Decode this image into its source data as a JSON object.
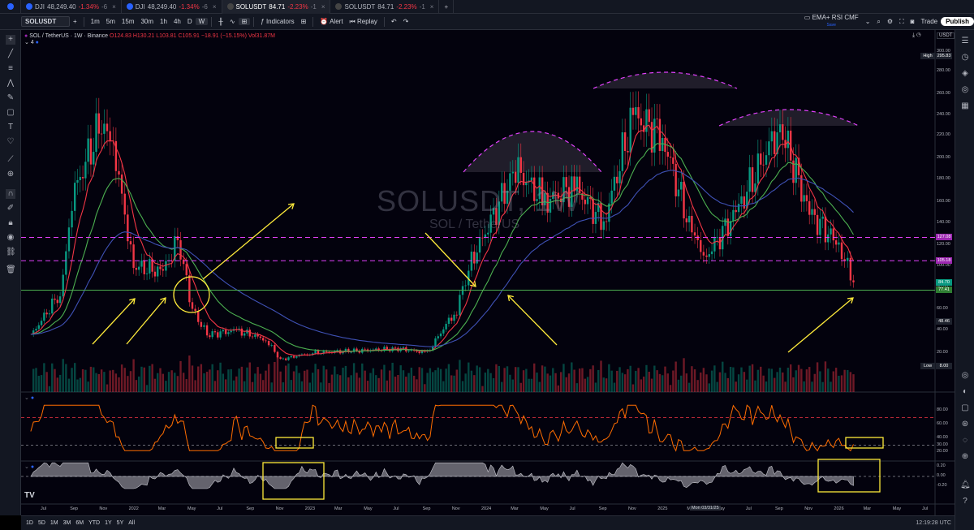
{
  "tabs": [
    {
      "symbol": "DJI",
      "price": "48,249.40",
      "change": "-1.34%",
      "extra": "-6",
      "active": false
    },
    {
      "symbol": "DJI",
      "price": "48,249.40",
      "change": "-1.34%",
      "extra": "-6",
      "active": false
    },
    {
      "symbol": "SOLUSDT",
      "price": "84.71",
      "change": "-2.23%",
      "extra": "-1",
      "active": true
    },
    {
      "symbol": "SOLUSDT",
      "price": "84.71",
      "change": "-2.23%",
      "extra": "-1",
      "active": false
    }
  ],
  "toolbar": {
    "symbol": "SOLUSDT",
    "intervals": [
      "1m",
      "5m",
      "15m",
      "30m",
      "1h",
      "4h",
      "D",
      "W"
    ],
    "selected_interval": "W",
    "indicators": "Indicators",
    "alert": "Alert",
    "replay": "Replay",
    "layout_name": "EMA+ RSI CMF",
    "layout_sub": "Save",
    "trade": "Trade",
    "publish": "Publish"
  },
  "legend": {
    "title": "SOL / TetherUS · 1W · Binance",
    "ohlc": "O124.83 H130.21 L103.81 C105.91 −18.91 (−15.15%) Vol31.87M",
    "indicator_count": "4"
  },
  "currency": "USDT",
  "watermark": {
    "symbol": "SOLUSDT, 1W",
    "name": "SOL / TetherUS"
  },
  "y_axis": [
    "300.00",
    "280.00",
    "260.00",
    "240.00",
    "220.00",
    "200.00",
    "180.00",
    "160.00",
    "140.00",
    "120.00",
    "100.00",
    "80.00",
    "60.00",
    "40.00",
    "20.00"
  ],
  "price_tags": [
    {
      "label": "High",
      "value": "295.83",
      "color": "#1e222d"
    },
    {
      "label": "",
      "value": "127.08",
      "color": "#9c27b0"
    },
    {
      "label": "",
      "value": "105.18",
      "color": "#9c27b0"
    },
    {
      "label": "",
      "value": "84.70",
      "color": "#089981"
    },
    {
      "label": "",
      "value": "77.41",
      "color": "#2e7d32"
    },
    {
      "label": "",
      "value": "48.46",
      "color": "#1e222d"
    },
    {
      "label": "Low",
      "value": "8.00",
      "color": "#1e222d"
    }
  ],
  "rsi_axis": [
    "80.00",
    "60.00",
    "40.00",
    "30.00",
    "20.00"
  ],
  "cmf_axis": [
    "0.20",
    "0.00",
    "-0.20"
  ],
  "x_axis": [
    "Jul",
    "Sep",
    "Nov",
    "2022",
    "Mar",
    "May",
    "Jul",
    "Sep",
    "Nov",
    "2023",
    "Mar",
    "May",
    "Jul",
    "Sep",
    "Nov",
    "2024",
    "Mar",
    "May",
    "Jul",
    "Sep",
    "Nov",
    "2025",
    "Mar",
    "May",
    "Jul",
    "Sep",
    "Nov",
    "2026",
    "Mar",
    "May",
    "Jul"
  ],
  "crosshair_date": "Mon 03/31/25",
  "bottombar": {
    "ranges": [
      "1D",
      "5D",
      "1M",
      "3M",
      "6M",
      "YTD",
      "1Y",
      "5Y",
      "All"
    ],
    "clock": "12:19:28 UTC"
  },
  "colors": {
    "up": "#089981",
    "down": "#f23645",
    "ema_fast": "#f23645",
    "ema_mid": "#4caf50",
    "ema_slow": "#3f51b5",
    "annotation": "#ffeb3b",
    "level": "#e040fb"
  },
  "chart_data": {
    "type": "candlestick",
    "title": "SOL / TetherUS · 1W · Binance",
    "ylim": [
      0,
      300
    ],
    "horizontal_levels": [
      127.08,
      105.18,
      77.41
    ],
    "price_close_series": [
      {
        "date": "2021-06",
        "value": 35
      },
      {
        "date": "2021-08",
        "value": 75
      },
      {
        "date": "2021-09",
        "value": 170
      },
      {
        "date": "2021-11",
        "value": 240
      },
      {
        "date": "2021-12",
        "value": 180
      },
      {
        "date": "2022-01",
        "value": 100
      },
      {
        "date": "2022-03",
        "value": 95
      },
      {
        "date": "2022-04",
        "value": 125
      },
      {
        "date": "2022-05",
        "value": 60
      },
      {
        "date": "2022-06",
        "value": 36
      },
      {
        "date": "2022-08",
        "value": 40
      },
      {
        "date": "2022-10",
        "value": 32
      },
      {
        "date": "2022-11",
        "value": 14
      },
      {
        "date": "2023-01",
        "value": 20
      },
      {
        "date": "2023-04",
        "value": 22
      },
      {
        "date": "2023-07",
        "value": 24
      },
      {
        "date": "2023-09",
        "value": 20
      },
      {
        "date": "2023-11",
        "value": 60
      },
      {
        "date": "2023-12",
        "value": 105
      },
      {
        "date": "2024-03",
        "value": 190
      },
      {
        "date": "2024-05",
        "value": 160
      },
      {
        "date": "2024-07",
        "value": 175
      },
      {
        "date": "2024-09",
        "value": 140
      },
      {
        "date": "2024-11",
        "value": 240
      },
      {
        "date": "2025-01",
        "value": 220
      },
      {
        "date": "2025-03",
        "value": 130
      },
      {
        "date": "2025-04",
        "value": 110
      },
      {
        "date": "2025-06",
        "value": 150
      },
      {
        "date": "2025-09",
        "value": 230
      },
      {
        "date": "2025-11",
        "value": 150
      },
      {
        "date": "2026-01",
        "value": 120
      },
      {
        "date": "2026-02",
        "value": 84.71
      }
    ],
    "last_close": 84.71
  }
}
